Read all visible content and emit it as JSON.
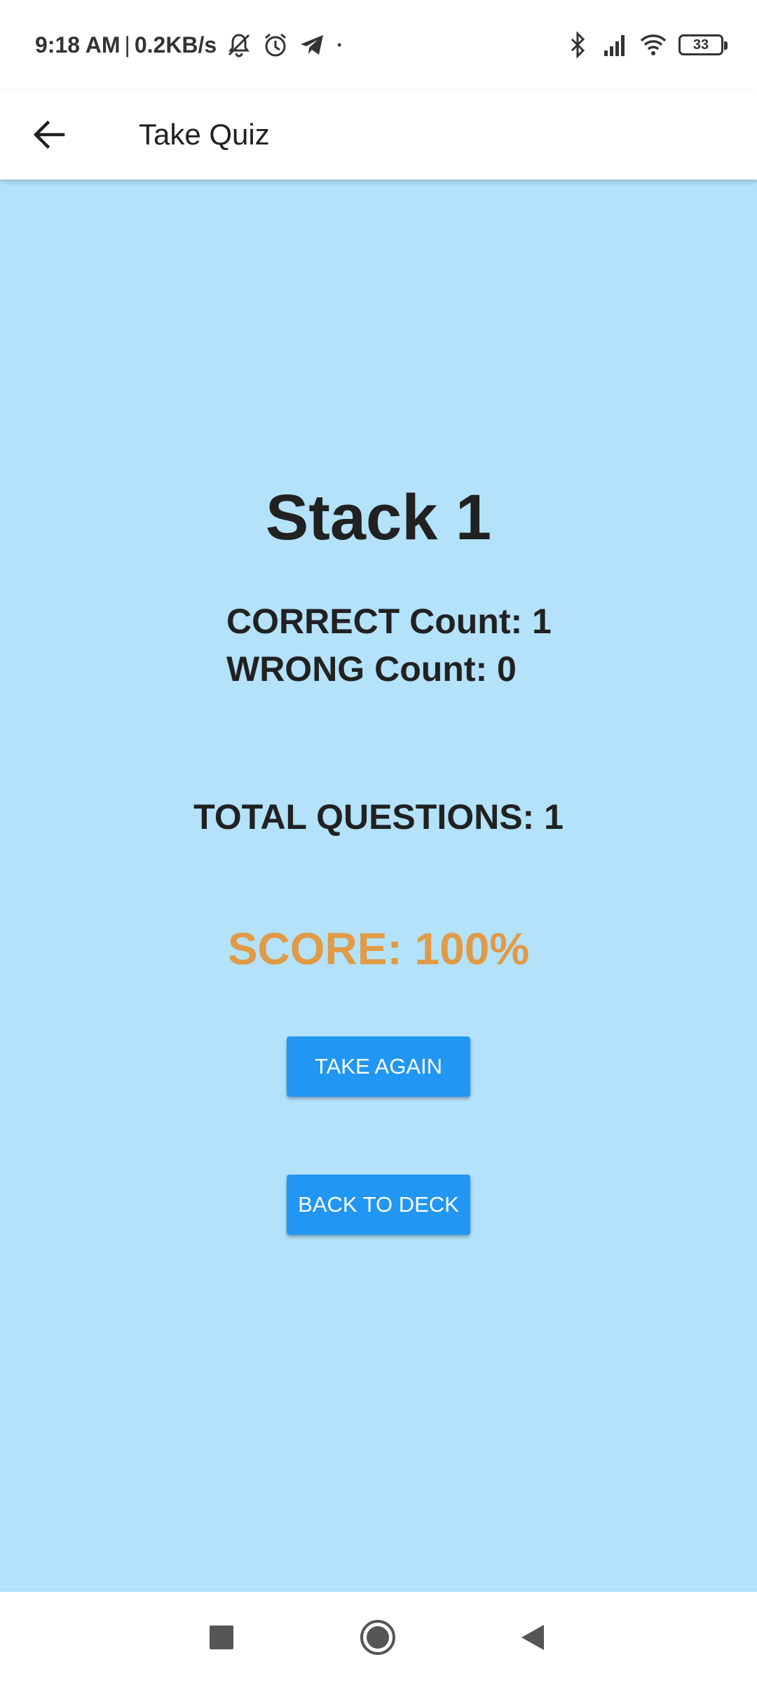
{
  "status_bar": {
    "time": "9:18 AM",
    "separator": "|",
    "net_speed": "0.2KB/s",
    "battery_level": "33",
    "icons_left": [
      "mute-icon",
      "alarm-icon",
      "telegram-icon",
      "dot-icon"
    ],
    "icons_right": [
      "bluetooth-icon",
      "signal-icon",
      "wifi-icon",
      "battery-icon"
    ]
  },
  "app_bar": {
    "title": "Take Quiz",
    "back_icon": "arrow-left-icon"
  },
  "result": {
    "deck_title": "Stack 1",
    "correct_label": "CORRECT Count: 1",
    "wrong_label": "WRONG Count: 0",
    "total_label": "TOTAL QUESTIONS: 1",
    "score_label": "SCORE: 100%"
  },
  "actions": {
    "take_again": "TAKE AGAIN",
    "back_to_deck": "BACK TO DECK"
  },
  "nav_bar": {
    "icons": [
      "recents-square-icon",
      "home-circle-icon",
      "back-triangle-icon"
    ]
  },
  "colors": {
    "background": "#b3e2fa",
    "button": "#2196f3",
    "score": "#e19a45",
    "text": "#212121"
  }
}
